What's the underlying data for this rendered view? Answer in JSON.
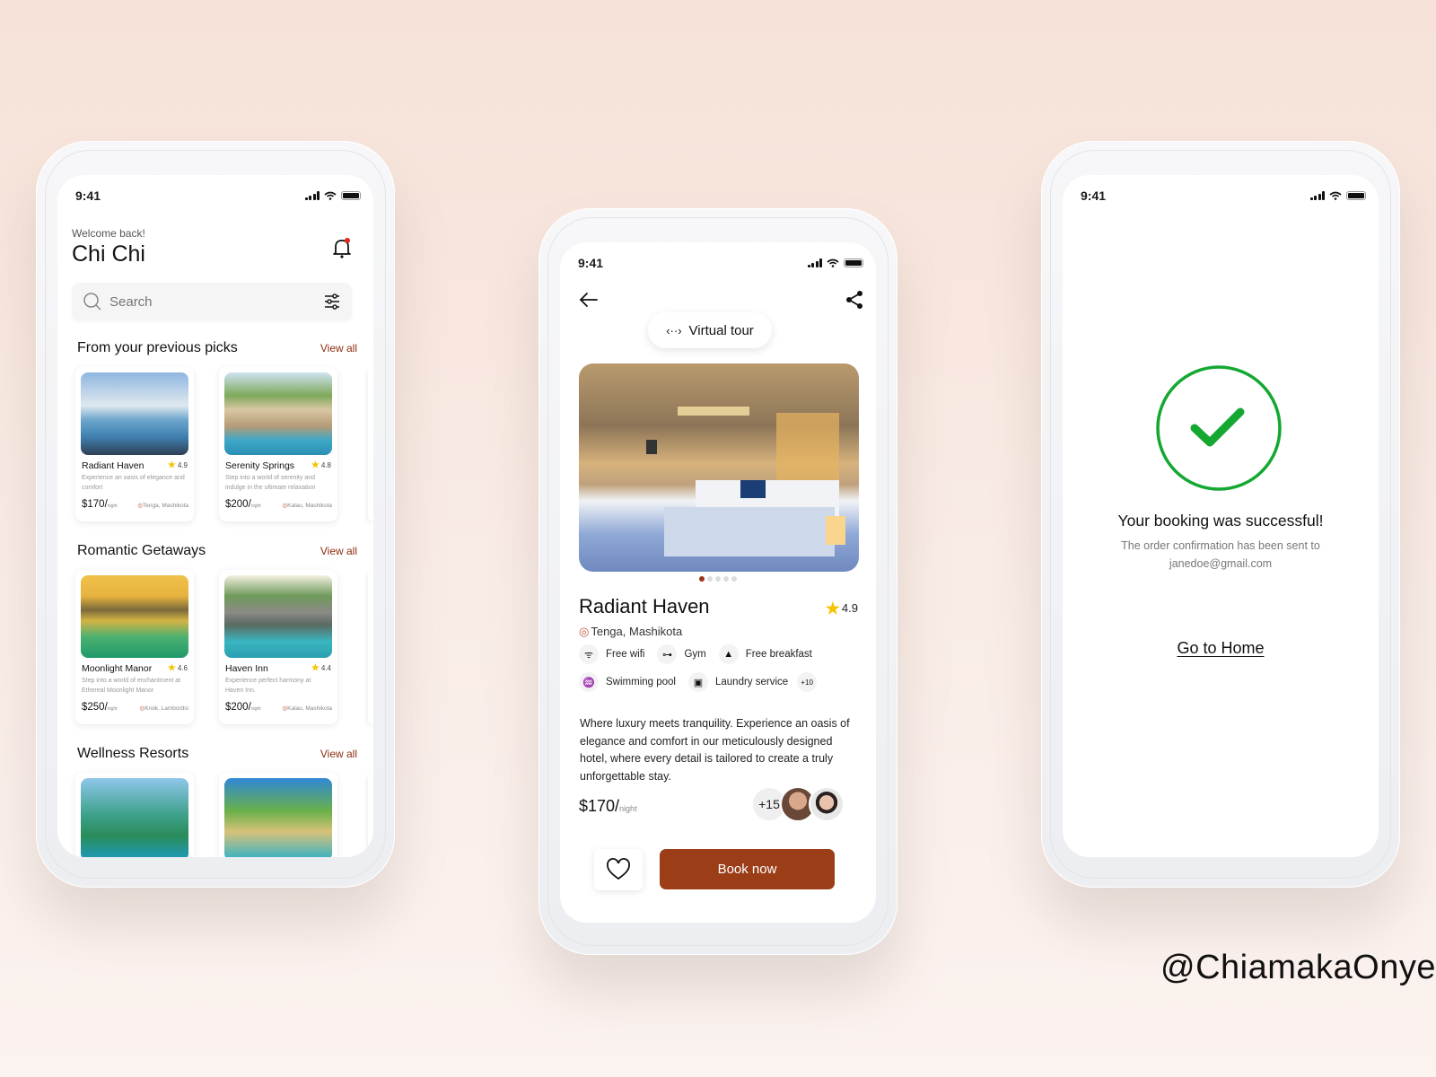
{
  "status_bar": {
    "time": "9:41"
  },
  "home": {
    "greeting": "Welcome back!",
    "user_name": "Chi Chi",
    "search_placeholder": "Search",
    "view_all": "View all",
    "sections": [
      {
        "title": "From your previous picks",
        "cards": [
          {
            "name": "Radiant Haven",
            "rating": "4.9",
            "desc": "Experience an oasis of elegance and comfort",
            "price": "$170/",
            "unit": "night",
            "location": "Tenga, Mashikota"
          },
          {
            "name": "Serenity Springs",
            "rating": "4.8",
            "desc": "Step into a world of serenity and indulge in the ultimate relaxation",
            "price": "$200/",
            "unit": "night",
            "location": "Kalau, Mashikota"
          }
        ]
      },
      {
        "title": "Romantic Getaways",
        "cards": [
          {
            "name": "Moonlight Manor",
            "rating": "4.6",
            "desc": "Step into a world of enchantment at Ethereal Moonlight Manor",
            "price": "$250/",
            "unit": "night",
            "location": "Kroik, Lambordsi"
          },
          {
            "name": "Haven Inn",
            "rating": "4.4",
            "desc": "Experience perfect harmony at Haven Inn.",
            "price": "$200/",
            "unit": "night",
            "location": "Kalau, Mashikota"
          }
        ]
      },
      {
        "title": "Wellness Resorts",
        "cards": []
      }
    ]
  },
  "detail": {
    "virtual_tour": "Virtual tour",
    "name": "Radiant Haven",
    "rating": "4.9",
    "location": "Tenga, Mashikota",
    "carousel": {
      "total": 5,
      "active": 1
    },
    "amenities": [
      "Free wifi",
      "Gym",
      "Free breakfast",
      "Swimming pool",
      "Laundry service"
    ],
    "more_amenities": "+10",
    "description": "Where luxury meets tranquility. Experience an oasis of elegance and comfort in our meticulously designed hotel, where every detail is tailored to create a truly unforgettable stay.",
    "price": "$170/",
    "price_unit": "night",
    "guests_more": "+15",
    "book_label": "Book now"
  },
  "success": {
    "title": "Your booking was successful!",
    "subtitle": "The order confirmation has been sent to janedoe@gmail.com",
    "home_link": "Go to Home"
  },
  "credit": "@ChiamakaOnye",
  "colors": {
    "accent": "#9b3e18",
    "success": "#14a832",
    "star": "#f5c400"
  }
}
